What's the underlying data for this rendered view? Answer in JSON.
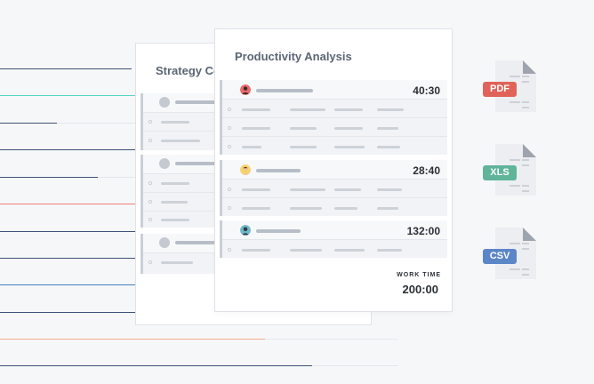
{
  "cards": {
    "back_title": "Strategy Co",
    "front_title": "Productivity Analysis"
  },
  "entries": [
    {
      "time": "40:30"
    },
    {
      "time": "28:40"
    },
    {
      "time": "132:00"
    }
  ],
  "summary": {
    "label": "WORK TIME",
    "value": "200:00"
  },
  "files": [
    {
      "label": "PDF",
      "color": "#e0635a"
    },
    {
      "label": "XLS",
      "color": "#5fb49a"
    },
    {
      "label": "CSV",
      "color": "#5b86c7"
    }
  ],
  "colors": {
    "line_dark": "#3e5276",
    "line_teal": "#56d6c9",
    "line_red": "#ef7e74",
    "line_blue": "#4a7fc1",
    "line_orange": "#f3ad92"
  }
}
